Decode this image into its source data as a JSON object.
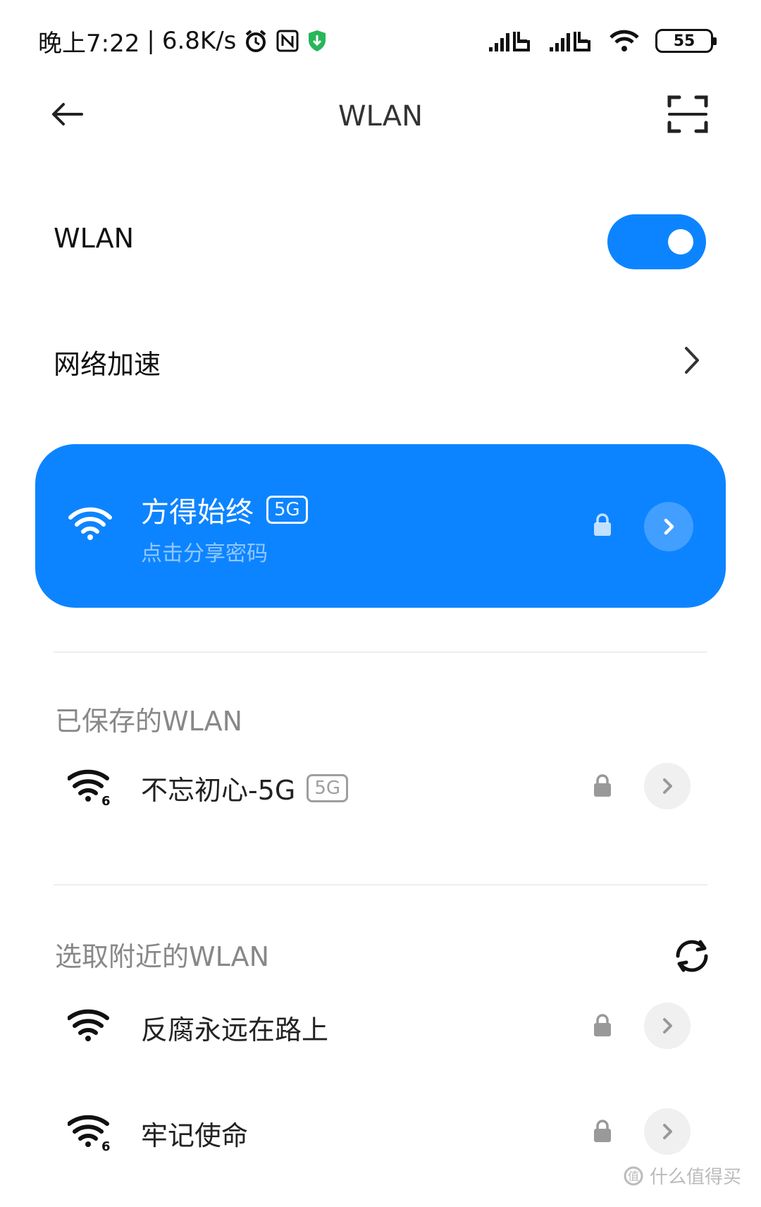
{
  "status_bar": {
    "time_text": "晚上7:22",
    "speed_text": "6.8K/s",
    "battery_level": "55"
  },
  "header": {
    "title": "WLAN"
  },
  "wlan_toggle": {
    "label": "WLAN",
    "enabled": true
  },
  "network_acceleration": {
    "label": "网络加速"
  },
  "connected_network": {
    "name": "方得始终",
    "band_badge": "5G",
    "subtitle": "点击分享密码",
    "secured": true
  },
  "saved_networks": {
    "header": "已保存的WLAN",
    "items": [
      {
        "name": "不忘初心-5G",
        "band_badge": "5G",
        "wifi_standard": "6",
        "secured": true
      }
    ]
  },
  "nearby_networks": {
    "header": "选取附近的WLAN",
    "items": [
      {
        "name": "反腐永远在路上",
        "wifi_standard": "",
        "secured": true
      },
      {
        "name": "牢记使命",
        "wifi_standard": "6",
        "secured": true
      }
    ]
  },
  "watermark": {
    "text": "什么值得买"
  },
  "colors": {
    "accent": "#0d84ff",
    "text_primary": "#111111",
    "text_secondary": "#888888",
    "divider": "#eeeeee"
  }
}
